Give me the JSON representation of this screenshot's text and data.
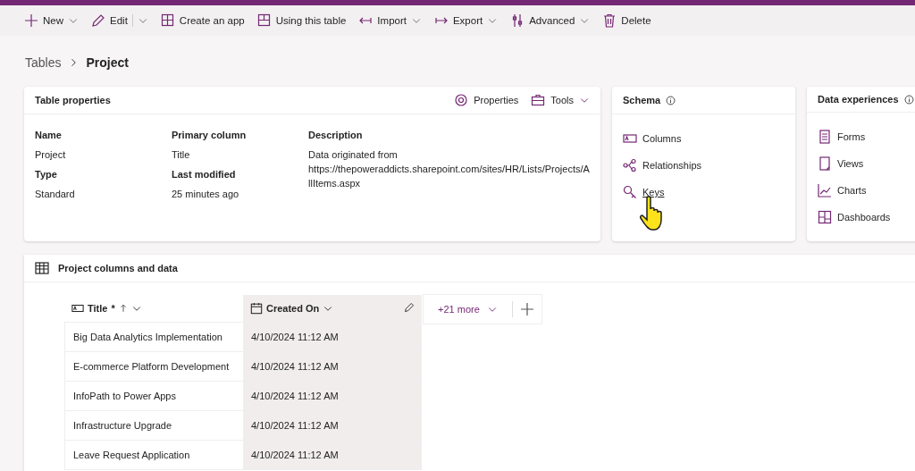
{
  "toolbar": [
    {
      "label": "New",
      "dropdown": true,
      "split": false
    },
    {
      "label": "Edit",
      "dropdown": true,
      "split": true
    },
    {
      "label": "Create an app",
      "dropdown": false,
      "split": false
    },
    {
      "label": "Using this table",
      "dropdown": false,
      "split": false
    },
    {
      "label": "Import",
      "dropdown": true,
      "split": false
    },
    {
      "label": "Export",
      "dropdown": true,
      "split": false
    },
    {
      "label": "Advanced",
      "dropdown": true,
      "split": false
    },
    {
      "label": "Delete",
      "dropdown": false,
      "split": false
    }
  ],
  "breadcrumb": {
    "parent": "Tables",
    "current": "Project"
  },
  "table_properties": {
    "title": "Table properties",
    "actions": [
      {
        "label": "Properties",
        "dropdown": false
      },
      {
        "label": "Tools",
        "dropdown": true
      }
    ],
    "columns": [
      [
        {
          "label": "Name",
          "value": "Project"
        },
        {
          "label": "Type",
          "value": "Standard"
        }
      ],
      [
        {
          "label": "Primary column",
          "value": "Title"
        },
        {
          "label": "Last modified",
          "value": "25 minutes ago"
        }
      ],
      [
        {
          "label": "Description",
          "value": "Data originated from https://thepoweraddicts.sharepoint.com/sites/HR/Lists/Projects/AllItems.aspx"
        }
      ]
    ]
  },
  "schema": {
    "title": "Schema",
    "items": [
      {
        "label": "Columns",
        "hovered": false
      },
      {
        "label": "Relationships",
        "hovered": false
      },
      {
        "label": "Keys",
        "hovered": true
      }
    ]
  },
  "data_experiences": {
    "title": "Data experiences",
    "items": [
      {
        "label": "Forms"
      },
      {
        "label": "Views"
      },
      {
        "label": "Charts"
      },
      {
        "label": "Dashboards"
      }
    ]
  },
  "data_panel": {
    "title": "Project columns and data",
    "columns": [
      {
        "label": "Title",
        "required_mark": "*",
        "sorted": true,
        "selected": false
      },
      {
        "label": "Created On",
        "sorted": false,
        "selected": true
      }
    ],
    "more": "+21 more",
    "rows": [
      [
        "Big Data Analytics Implementation",
        "4/10/2024 11:12 AM"
      ],
      [
        "E-commerce Platform Development",
        "4/10/2024 11:12 AM"
      ],
      [
        "InfoPath to Power Apps",
        "4/10/2024 11:12 AM"
      ],
      [
        "Infrastructure Upgrade",
        "4/10/2024 11:12 AM"
      ],
      [
        "Leave Request Application",
        "4/10/2024 11:12 AM"
      ]
    ]
  }
}
